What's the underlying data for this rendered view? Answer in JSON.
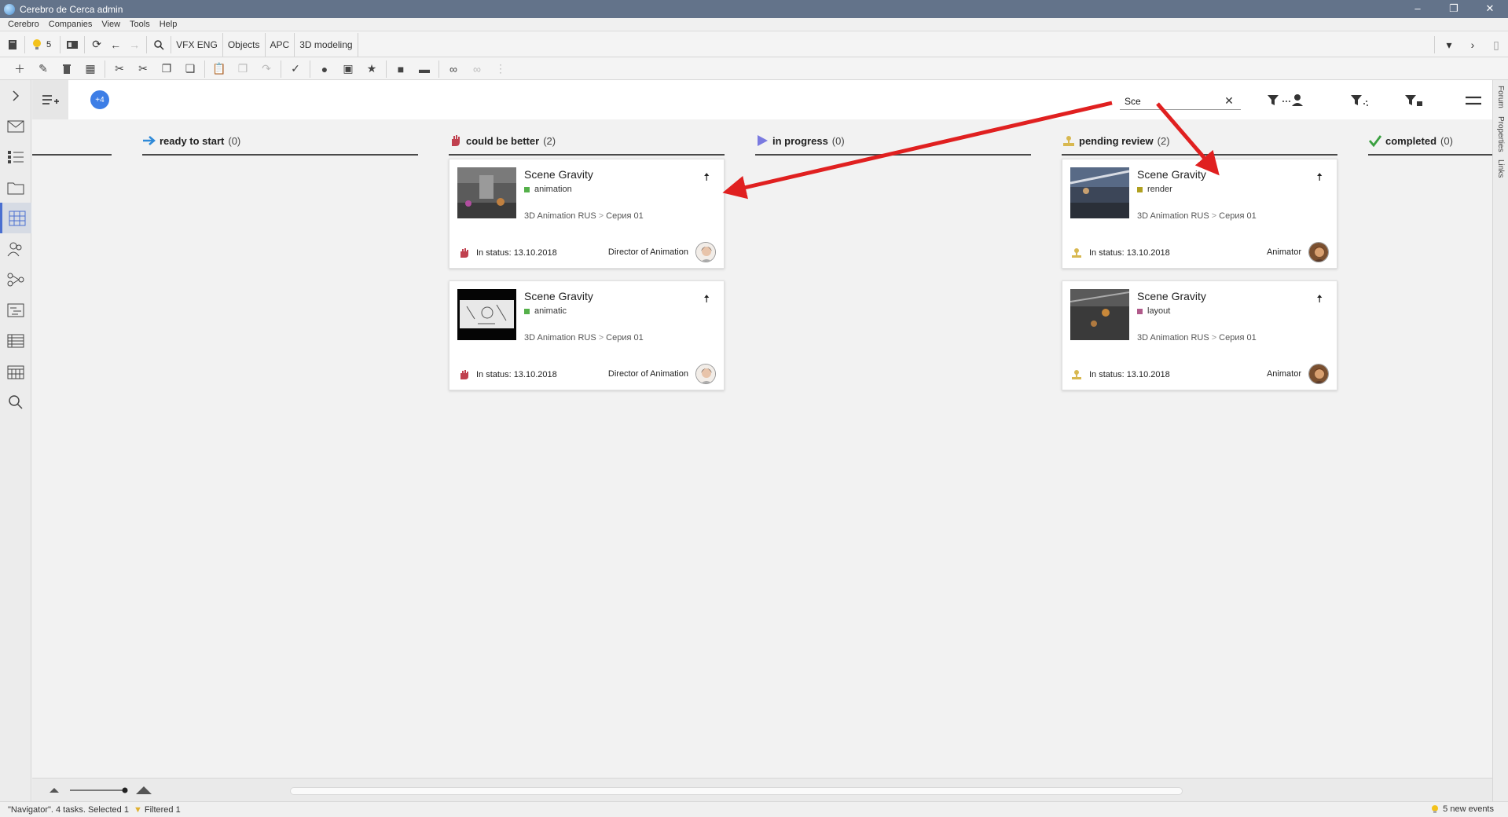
{
  "window": {
    "title": "Cerebro de Cerca  admin"
  },
  "menu": [
    "Cerebro",
    "Companies",
    "View",
    "Tools",
    "Help"
  ],
  "toolbar1": {
    "bulb_count": "5",
    "tabs": [
      "VFX ENG",
      "Objects",
      "APC",
      "3D modeling"
    ]
  },
  "rightbar": [
    "Forum",
    "Properties",
    "Links"
  ],
  "board": {
    "badge": "+4",
    "search": {
      "value": "Sce"
    },
    "columns": [
      {
        "label": "ready to start",
        "count": "(0)",
        "icon": "arrow-right-icon",
        "color": "#2f8ad8"
      },
      {
        "label": "could be better",
        "count": "(2)",
        "icon": "hand-icon",
        "color": "#c0404e"
      },
      {
        "label": "in progress",
        "count": "(0)",
        "icon": "play-icon",
        "color": "#7a7ae0"
      },
      {
        "label": "pending review",
        "count": "(2)",
        "icon": "stamp-icon",
        "color": "#d8b850"
      },
      {
        "label": "completed",
        "count": "(0)",
        "icon": "check-icon",
        "color": "#3aa040"
      }
    ],
    "cards": [
      {
        "title": "Scene Gravity",
        "tag": "animation",
        "tag_color": "#55b04a",
        "path_project": "3D Animation RUS",
        "path_sep": ">",
        "path_item": "Серия 01",
        "status": "In status: 13.10.2018",
        "role": "Director of Animation"
      },
      {
        "title": "Scene Gravity",
        "tag": "animatic",
        "tag_color": "#55b04a",
        "path_project": "3D Animation RUS",
        "path_sep": ">",
        "path_item": "Серия 01",
        "status": "In status: 13.10.2018",
        "role": "Director of Animation"
      },
      {
        "title": "Scene Gravity",
        "tag": "render",
        "tag_color": "#b0a020",
        "path_project": "3D Animation RUS",
        "path_sep": ">",
        "path_item": "Серия 01",
        "status": "In status: 13.10.2018",
        "role": "Animator"
      },
      {
        "title": "Scene Gravity",
        "tag": "layout",
        "tag_color": "#b05a8a",
        "path_project": "3D Animation RUS",
        "path_sep": ">",
        "path_item": "Серия 01",
        "status": "In status: 13.10.2018",
        "role": "Animator"
      }
    ]
  },
  "statusbar": {
    "text": "\"Navigator\". 4 tasks. Selected 1",
    "filtered": "Filtered 1",
    "events": "5 new events"
  }
}
